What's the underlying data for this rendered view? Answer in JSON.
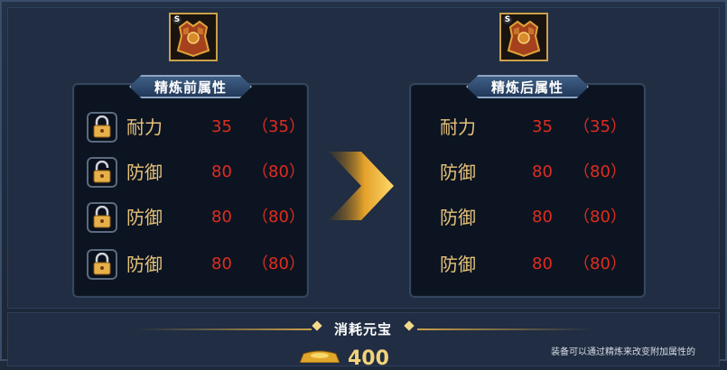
{
  "before_panel": {
    "title": "精炼前属性",
    "rows": [
      {
        "name": "耐力",
        "value": "35",
        "max": "（35）",
        "lock": "locked"
      },
      {
        "name": "防御",
        "value": "80",
        "max": "（80）",
        "lock": "unlocked"
      },
      {
        "name": "防御",
        "value": "80",
        "max": "（80）",
        "lock": "locked"
      },
      {
        "name": "防御",
        "value": "80",
        "max": "（80）",
        "lock": "locked"
      }
    ]
  },
  "after_panel": {
    "title": "精炼后属性",
    "rows": [
      {
        "name": "耐力",
        "value": "35",
        "max": "（35）"
      },
      {
        "name": "防御",
        "value": "80",
        "max": "（80）"
      },
      {
        "name": "防御",
        "value": "80",
        "max": "（80）"
      },
      {
        "name": "防御",
        "value": "80",
        "max": "（80）"
      }
    ]
  },
  "item": {
    "badge": "S",
    "icon": "armor-chestplate-icon"
  },
  "cost": {
    "title": "消耗元宝",
    "value": "400",
    "icon": "gold-ingot-icon"
  },
  "note": "装备可以通过精炼来改变附加属性的",
  "colors": {
    "attr_name": "#e6c27a",
    "attr_value": "#e02c20",
    "panel_bg": "#0c1421",
    "frame_bg": "#1e2a3c",
    "accent_gold": "#c9a04a"
  }
}
